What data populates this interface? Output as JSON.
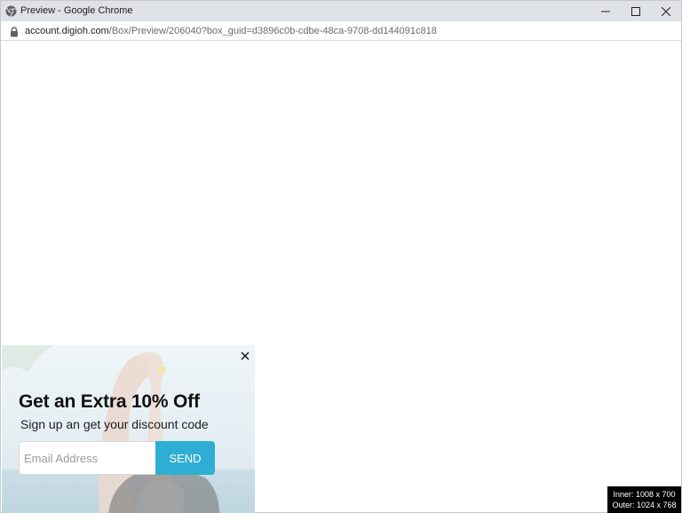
{
  "window": {
    "title": "Preview - Google Chrome",
    "controls": {
      "minimize": "minimize",
      "maximize": "maximize",
      "close": "close"
    }
  },
  "address": {
    "host": "account.digioh.com",
    "path": "/Box/Preview/206040?box_guid=d3896c0b-cdbe-48ca-9708-dd144091c818"
  },
  "popup": {
    "heading": "Get an Extra 10% Off",
    "subheading": "Sign up an get your discount code",
    "email_placeholder": "Email Address",
    "send_label": "SEND",
    "accent_color": "#2eaed4"
  },
  "dimensions": {
    "inner": "Inner: 1008 x 700",
    "outer": "Outer: 1024 x 768"
  },
  "icons": {
    "app": "chrome-icon",
    "lock": "lock-icon",
    "popup_close": "close-icon"
  }
}
